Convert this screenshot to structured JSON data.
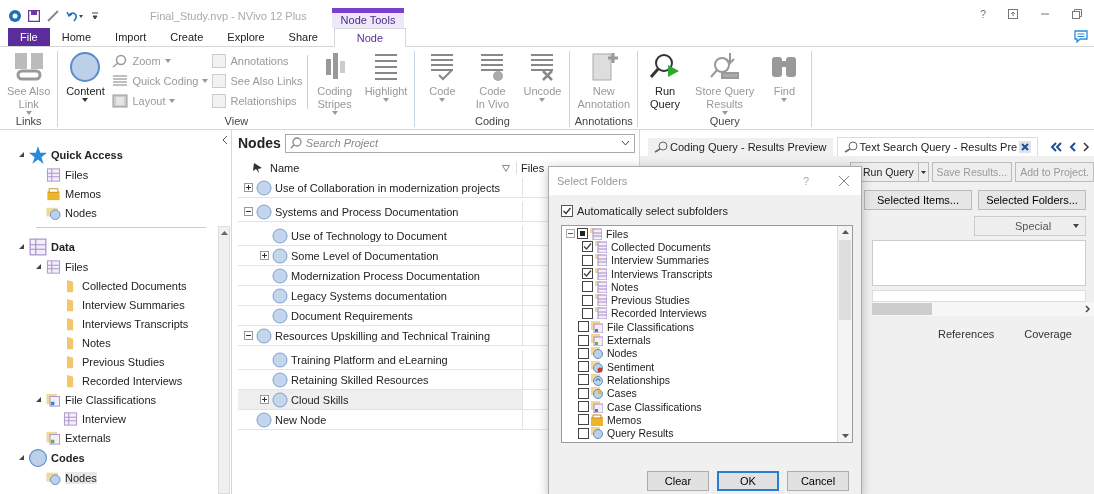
{
  "titlebar": {
    "title": "Final_Study.nvp - NVivo 12 Plus",
    "context_tab": "Node Tools",
    "help": "?"
  },
  "menu_tabs": [
    {
      "label": "File",
      "kind": "file",
      "selected": false
    },
    {
      "label": "Home",
      "kind": "tab",
      "selected": false
    },
    {
      "label": "Import",
      "kind": "tab",
      "selected": false
    },
    {
      "label": "Create",
      "kind": "tab",
      "selected": false
    },
    {
      "label": "Explore",
      "kind": "tab",
      "selected": false
    },
    {
      "label": "Share",
      "kind": "tab",
      "selected": false
    },
    {
      "label": "Node",
      "kind": "tab",
      "selected": true
    }
  ],
  "ribbon": {
    "groups": [
      {
        "label": "Links",
        "items": [
          {
            "kind": "large",
            "lines": [
              "See Also",
              "Link"
            ],
            "dropdown": true,
            "disabled": true
          }
        ]
      },
      {
        "label": "View",
        "items": [
          {
            "kind": "large",
            "lines": [
              "Content"
            ],
            "dropdown": true,
            "disabled": false
          },
          {
            "kind": "small",
            "label": "Zoom",
            "dropdown": true,
            "disabled": true
          },
          {
            "kind": "small",
            "label": "Quick Coding",
            "dropdown": true,
            "disabled": true
          },
          {
            "kind": "small",
            "label": "Layout",
            "dropdown": true,
            "disabled": true
          },
          {
            "kind": "check",
            "label": "Annotations",
            "checked": false,
            "disabled": true
          },
          {
            "kind": "check",
            "label": "See Also Links",
            "checked": false,
            "disabled": true
          },
          {
            "kind": "check",
            "label": "Relationships",
            "checked": false,
            "disabled": true
          },
          {
            "kind": "large",
            "lines": [
              "Coding",
              "Stripes"
            ],
            "dropdown": true,
            "disabled": true
          },
          {
            "kind": "large",
            "lines": [
              "Highlight"
            ],
            "dropdown": true,
            "disabled": true
          }
        ]
      },
      {
        "label": "Coding",
        "items": [
          {
            "kind": "large",
            "lines": [
              "Code"
            ],
            "dropdown": true,
            "disabled": true
          },
          {
            "kind": "large",
            "lines": [
              "Code",
              "In Vivo"
            ],
            "dropdown": false,
            "disabled": true
          },
          {
            "kind": "large",
            "lines": [
              "Uncode"
            ],
            "dropdown": true,
            "disabled": true
          }
        ]
      },
      {
        "label": "Annotations",
        "items": [
          {
            "kind": "large",
            "lines": [
              "New",
              "Annotation"
            ],
            "dropdown": false,
            "disabled": true
          }
        ]
      },
      {
        "label": "Query",
        "items": [
          {
            "kind": "large",
            "lines": [
              "Run",
              "Query"
            ],
            "dropdown": false,
            "disabled": false
          },
          {
            "kind": "large",
            "lines": [
              "Store Query",
              "Results"
            ],
            "dropdown": true,
            "disabled": true
          },
          {
            "kind": "large",
            "lines": [
              "Find"
            ],
            "dropdown": true,
            "disabled": true
          }
        ]
      }
    ]
  },
  "nav": {
    "items": [
      {
        "label": "Quick Access",
        "kind": "star",
        "expanded": true,
        "selected": false,
        "children": [
          {
            "label": "Files",
            "kind": "files",
            "selected": false
          },
          {
            "label": "Memos",
            "kind": "memos",
            "selected": false
          },
          {
            "label": "Nodes",
            "kind": "nodes",
            "selected": false
          }
        ]
      },
      {
        "label": "Data",
        "kind": "data",
        "expanded": true,
        "selected": false,
        "children": [
          {
            "label": "Files",
            "kind": "files",
            "expanded": true,
            "selected": false,
            "children": [
              {
                "label": "Collected Documents",
                "kind": "folder",
                "selected": false
              },
              {
                "label": "Interview Summaries",
                "kind": "folder",
                "selected": false
              },
              {
                "label": "Interviews Transcripts",
                "kind": "folder",
                "selected": false
              },
              {
                "label": "Notes",
                "kind": "folder",
                "selected": false
              },
              {
                "label": "Previous Studies",
                "kind": "folder",
                "selected": false
              },
              {
                "label": "Recorded Interviews",
                "kind": "folder",
                "selected": false
              }
            ]
          },
          {
            "label": "File Classifications",
            "kind": "classifications",
            "expanded": true,
            "selected": false,
            "children": [
              {
                "label": "Interview",
                "kind": "classification",
                "selected": false
              }
            ]
          },
          {
            "label": "Externals",
            "kind": "externals",
            "selected": false
          }
        ]
      },
      {
        "label": "Codes",
        "kind": "nodes",
        "expanded": true,
        "selected": false,
        "children": [
          {
            "label": "Nodes",
            "kind": "nodes",
            "selected": true
          }
        ]
      }
    ]
  },
  "nodes_panel": {
    "title": "Nodes",
    "search": {
      "placeholder": "Search Project"
    },
    "columns": [
      "Name",
      "Files"
    ],
    "rows": [
      {
        "label": "Use of Collaboration in modernization projects",
        "expanded": false,
        "selected": false
      },
      {
        "label": "Systems and Process Documentation",
        "expanded": true,
        "selected": false,
        "children": [
          {
            "label": "Use of Technology to Document",
            "selected": false
          },
          {
            "label": "Some Level of Documentation",
            "expanded": false,
            "selected": false
          },
          {
            "label": "Modernization Process Documentation",
            "selected": false
          },
          {
            "label": "Legacy Systems documentation",
            "selected": false
          },
          {
            "label": "Document Requirements",
            "selected": false
          }
        ]
      },
      {
        "label": "Resources Upskilling and Technical Training",
        "expanded": true,
        "selected": false,
        "children": [
          {
            "label": "Training Platform and eLearning",
            "selected": false
          },
          {
            "label": "Retaining Skilled Resources",
            "selected": false
          },
          {
            "label": "Cloud Skills",
            "expanded": false,
            "selected": true
          }
        ]
      },
      {
        "label": "New Node",
        "selected": false
      }
    ]
  },
  "results": {
    "tabs": [
      {
        "label": "Coding Query - Results Preview",
        "selected": false,
        "closable": false
      },
      {
        "label": "Text Search Query - Results Pre",
        "selected": true,
        "closable": true
      }
    ],
    "toolbar": [
      {
        "label": "Run Query",
        "split": true,
        "disabled": false
      },
      {
        "label": "Save Results...",
        "split": false,
        "disabled": true
      },
      {
        "label": "Add to Project.",
        "split": false,
        "disabled": true
      }
    ],
    "scope_buttons": [
      "Selected Items...",
      "Selected Folders..."
    ],
    "special": "Special",
    "columns": [
      "References",
      "Coverage"
    ]
  },
  "dialog": {
    "title": "Select Folders",
    "help": "?",
    "auto_select": {
      "label": "Automatically select subfolders",
      "checked": true
    },
    "items": [
      {
        "label": "Files",
        "kind": "files",
        "checked": false,
        "partial": true,
        "expanded": true,
        "children": [
          {
            "label": "Collected Documents",
            "kind": "files",
            "checked": true,
            "partial": false
          },
          {
            "label": "Interview Summaries",
            "kind": "files",
            "checked": false,
            "partial": false
          },
          {
            "label": "Interviews Transcripts",
            "kind": "files",
            "checked": true,
            "partial": false
          },
          {
            "label": "Notes",
            "kind": "files",
            "checked": false,
            "partial": false
          },
          {
            "label": "Previous Studies",
            "kind": "files",
            "checked": false,
            "partial": false
          },
          {
            "label": "Recorded Interviews",
            "kind": "files",
            "checked": false,
            "partial": false
          }
        ]
      },
      {
        "label": "File Classifications",
        "kind": "classifications",
        "checked": false,
        "partial": false
      },
      {
        "label": "Externals",
        "kind": "externals",
        "checked": false,
        "partial": false
      },
      {
        "label": "Nodes",
        "kind": "nodes",
        "checked": false,
        "partial": false
      },
      {
        "label": "Sentiment",
        "kind": "sentiment",
        "checked": false,
        "partial": false
      },
      {
        "label": "Relationships",
        "kind": "relationships",
        "checked": false,
        "partial": false
      },
      {
        "label": "Cases",
        "kind": "cases",
        "checked": false,
        "partial": false
      },
      {
        "label": "Case Classifications",
        "kind": "classifications",
        "checked": false,
        "partial": false
      },
      {
        "label": "Memos",
        "kind": "memos",
        "checked": false,
        "partial": false
      },
      {
        "label": "Query Results",
        "kind": "query",
        "checked": false,
        "partial": false
      }
    ],
    "buttons": [
      {
        "label": "Clear",
        "default": false
      },
      {
        "label": "OK",
        "default": true
      },
      {
        "label": "Cancel",
        "default": false
      }
    ]
  }
}
